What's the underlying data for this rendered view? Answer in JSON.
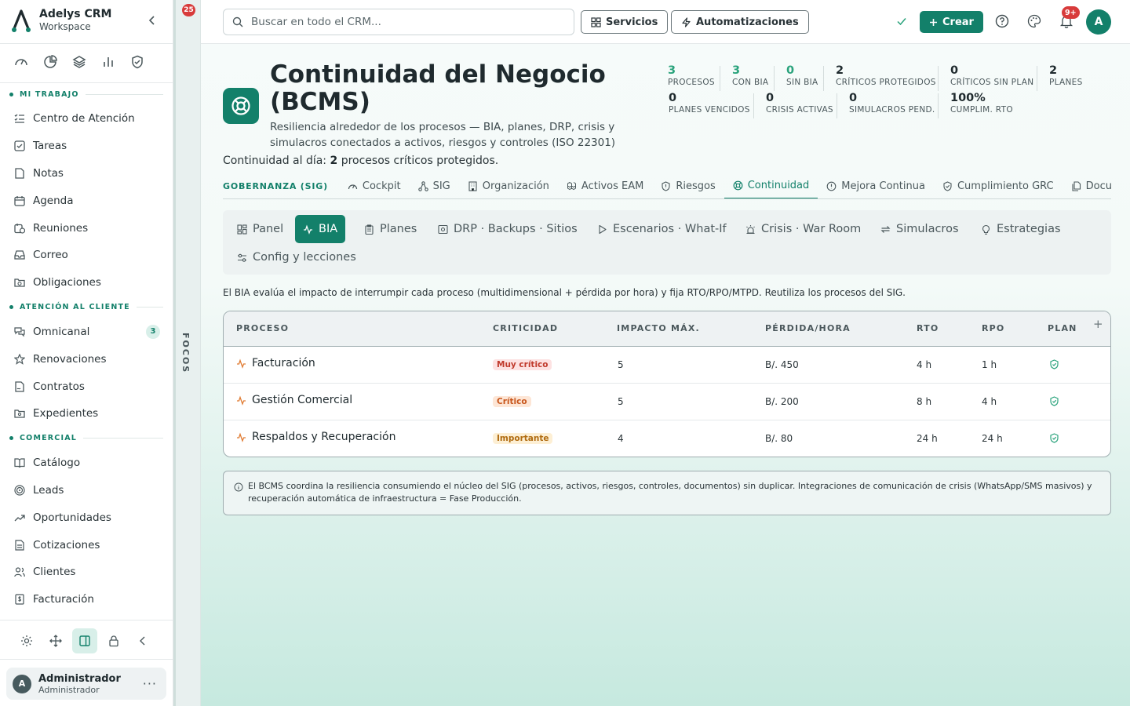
{
  "app": {
    "name": "Adelys CRM",
    "workspace": "Workspace"
  },
  "sidebar": {
    "sections": [
      {
        "label": "MI TRABAJO",
        "items": [
          {
            "label": "Centro de Atención",
            "icon": "list-check-icon"
          },
          {
            "label": "Tareas",
            "icon": "checkbox-icon"
          },
          {
            "label": "Notas",
            "icon": "note-icon"
          },
          {
            "label": "Agenda",
            "icon": "calendar-icon"
          },
          {
            "label": "Reuniones",
            "icon": "calendar-clock-icon"
          },
          {
            "label": "Correo",
            "icon": "inbox-icon"
          },
          {
            "label": "Obligaciones",
            "icon": "folder-clock-icon"
          }
        ]
      },
      {
        "label": "ATENCIÓN AL CLIENTE",
        "items": [
          {
            "label": "Omnicanal",
            "icon": "chat-icon",
            "count": "3"
          },
          {
            "label": "Renovaciones",
            "icon": "star-icon"
          },
          {
            "label": "Contratos",
            "icon": "file-signature-icon"
          },
          {
            "label": "Expedientes",
            "icon": "folder-search-icon"
          }
        ]
      },
      {
        "label": "COMERCIAL",
        "items": [
          {
            "label": "Catálogo",
            "icon": "book-icon"
          },
          {
            "label": "Leads",
            "icon": "target-icon"
          },
          {
            "label": "Oportunidades",
            "icon": "trending-up-icon"
          },
          {
            "label": "Cotizaciones",
            "icon": "document-icon"
          },
          {
            "label": "Clientes",
            "icon": "users-icon"
          },
          {
            "label": "Facturación",
            "icon": "receipt-icon"
          }
        ]
      }
    ]
  },
  "user": {
    "initial": "A",
    "name": "Administrador",
    "role": "Administrador"
  },
  "focos": {
    "label": "FOCOS",
    "badge": "25"
  },
  "topbar": {
    "search_placeholder": "Buscar en todo el CRM...",
    "services_label": "Servicios",
    "automations_label": "Automatizaciones",
    "create_label": "Crear",
    "notifications_badge": "9+",
    "avatar_initial": "A"
  },
  "page": {
    "title": "Continuidad del Negocio (BCMS)",
    "subtitle": "Resiliencia alrededor de los procesos — BIA, planes, DRP, crisis y simulacros conectados a activos, riesgos y controles (ISO 22301)",
    "summary_prefix": "Continuidad al día:",
    "summary_count": "2",
    "summary_suffix": "procesos críticos protegidos."
  },
  "kpis": [
    {
      "value": "3",
      "label": "PROCESOS",
      "accent": true
    },
    {
      "value": "3",
      "label": "CON BIA",
      "accent": true
    },
    {
      "value": "0",
      "label": "SIN BIA",
      "accent": true
    },
    {
      "value": "2",
      "label": "CRÍTICOS PROTEGIDOS",
      "accent": false
    },
    {
      "value": "0",
      "label": "CRÍTICOS SIN PLAN",
      "accent": false
    },
    {
      "value": "2",
      "label": "PLANES",
      "accent": false
    },
    {
      "value": "0",
      "label": "PLANES VENCIDOS",
      "accent": false
    },
    {
      "value": "0",
      "label": "CRISIS ACTIVAS",
      "accent": false
    },
    {
      "value": "0",
      "label": "SIMULACROS PEND.",
      "accent": false
    },
    {
      "value": "100%",
      "label": "CUMPLIM. RTO",
      "accent": false
    }
  ],
  "module_tabs": {
    "group_label": "GOBERNANZA (SIG)",
    "items": [
      {
        "label": "Cockpit"
      },
      {
        "label": "SIG"
      },
      {
        "label": "Organización"
      },
      {
        "label": "Activos EAM"
      },
      {
        "label": "Riesgos"
      },
      {
        "label": "Continuidad",
        "active": true
      },
      {
        "label": "Mejora Continua"
      },
      {
        "label": "Cumplimiento GRC"
      },
      {
        "label": "Docu"
      }
    ]
  },
  "sub_tabs": [
    {
      "label": "Panel"
    },
    {
      "label": "BIA",
      "active": true
    },
    {
      "label": "Planes"
    },
    {
      "label": "DRP · Backups · Sitios"
    },
    {
      "label": "Escenarios · What-If"
    },
    {
      "label": "Crisis · War Room"
    },
    {
      "label": "Simulacros"
    },
    {
      "label": "Estrategias"
    },
    {
      "label": "Config y lecciones"
    }
  ],
  "bia": {
    "description": "El BIA evalúa el impacto de interrumpir cada proceso (multidimensional + pérdida por hora) y fija RTO/RPO/MTPD. Reutiliza los procesos del SIG.",
    "columns": [
      "PROCESO",
      "CRITICIDAD",
      "IMPACTO MÁX.",
      "PÉRDIDA/HORA",
      "RTO",
      "RPO",
      "PLAN"
    ],
    "rows": [
      {
        "process": "Facturación",
        "criticality": "Muy crítico",
        "impact": "5",
        "loss": "B/. 450",
        "rto": "4 h",
        "rpo": "1 h"
      },
      {
        "process": "Gestión Comercial",
        "criticality": "Crítico",
        "impact": "5",
        "loss": "B/. 200",
        "rto": "8 h",
        "rpo": "4 h"
      },
      {
        "process": "Respaldos y Recuperación",
        "criticality": "Importante",
        "impact": "4",
        "loss": "B/. 80",
        "rto": "24 h",
        "rpo": "24 h"
      }
    ]
  },
  "note": "El BCMS coordina la resiliencia consumiendo el núcleo del SIG (procesos, activos, riesgos, controles, documentos) sin duplicar. Integraciones de comunicación de crisis (WhatsApp/SMS masivos) y recuperación automática de infraestructura = Fase Producción.",
  "colors": {
    "brand": "#13806a",
    "accent": "#2aa37c",
    "danger": "#d83b3b"
  }
}
